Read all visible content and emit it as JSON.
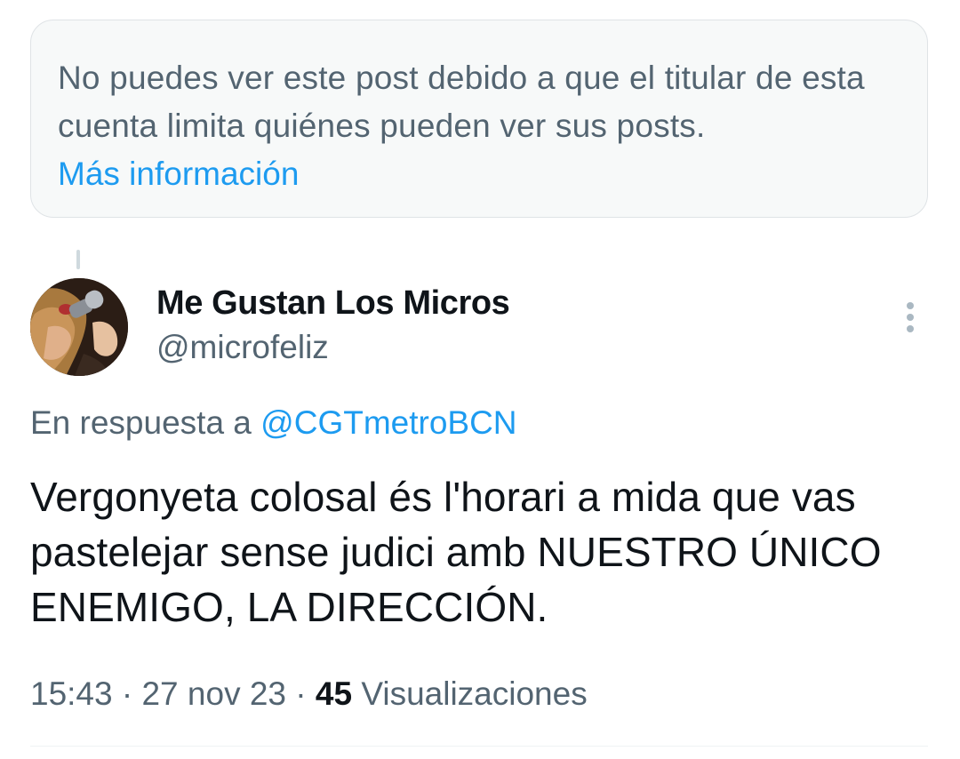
{
  "notice": {
    "text": "No puedes ver este post debido a que el titular de esta cuenta limita quiénes pueden ver sus posts.",
    "link_label": "Más información"
  },
  "tweet": {
    "author": {
      "display_name": "Me Gustan Los Micros",
      "handle": "@microfeliz"
    },
    "reply_prefix": "En respuesta a",
    "reply_to": "@CGTmetroBCN",
    "text": "Vergonyeta colosal és l'horari a mida que vas pastelejar sense judici amb NUESTRO ÚNICO ENEMIGO, LA DIRECCIÓN.",
    "time": "15:43",
    "separator": "·",
    "date": "27 nov 23",
    "views_count": "45",
    "views_label": "Visualizaciones"
  },
  "icons": {
    "more": "more-options-icon",
    "avatar": "profile-photo"
  },
  "colors": {
    "link": "#1d9bf0",
    "secondary_text": "#536471",
    "primary_text": "#0f1419",
    "notice_background": "#f7f9f9"
  }
}
